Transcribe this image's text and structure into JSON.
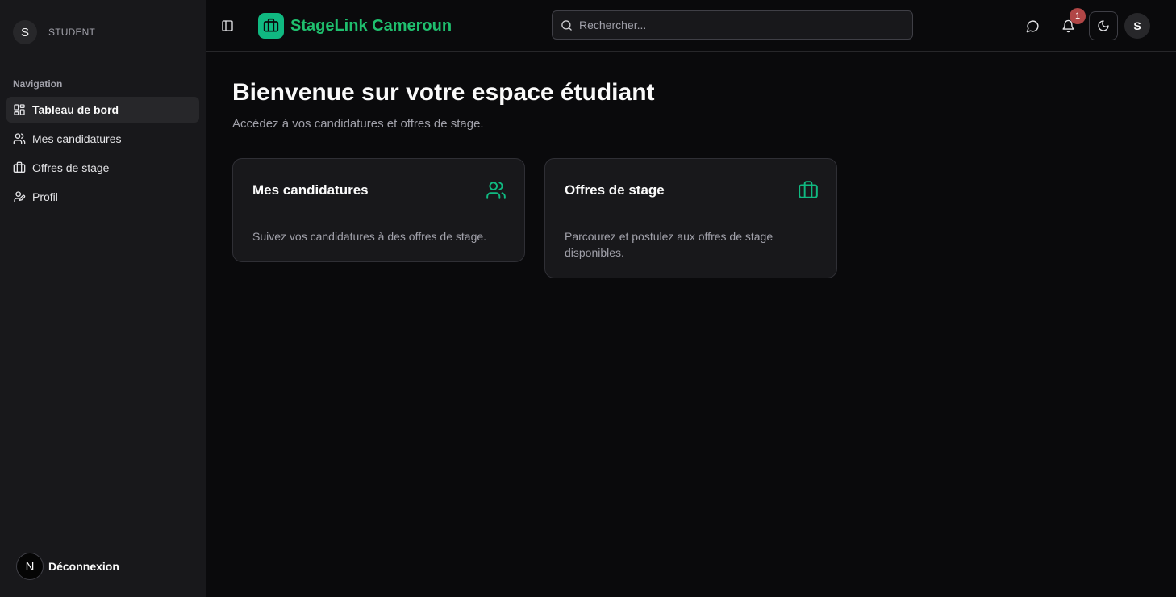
{
  "sidebar": {
    "avatar_letter": "S",
    "role": "STUDENT",
    "section_label": "Navigation",
    "items": [
      {
        "label": "Tableau de bord",
        "icon": "dashboard-icon",
        "active": true
      },
      {
        "label": "Mes candidatures",
        "icon": "users-icon",
        "active": false
      },
      {
        "label": "Offres de stage",
        "icon": "briefcase-icon",
        "active": false
      },
      {
        "label": "Profil",
        "icon": "user-cog-icon",
        "active": false
      }
    ],
    "logout_avatar_letter": "N",
    "logout_label": "Déconnexion"
  },
  "header": {
    "brand_name": "StageLink Cameroun",
    "search_placeholder": "Rechercher...",
    "notification_count": "1",
    "avatar_letter": "S"
  },
  "main": {
    "title": "Bienvenue sur votre espace étudiant",
    "subtitle": "Accédez à vos candidatures et offres de stage.",
    "cards": [
      {
        "title": "Mes candidatures",
        "icon": "users-icon",
        "description": "Suivez vos candidatures à des offres de stage."
      },
      {
        "title": "Offres de stage",
        "icon": "briefcase-icon",
        "description": "Parcourez et postulez aux offres de stage disponibles."
      }
    ]
  },
  "colors": {
    "accent": "#10b981",
    "background": "#0a0a0c",
    "sidebar": "#18181b",
    "badge": "#b14646"
  }
}
